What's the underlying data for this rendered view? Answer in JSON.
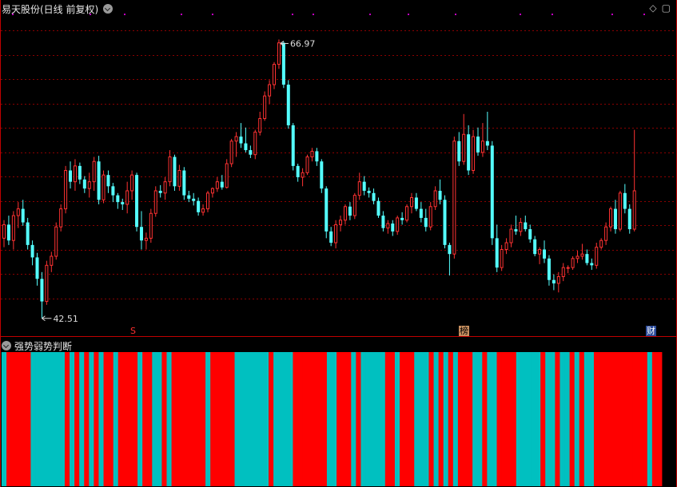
{
  "main_panel": {
    "title": "易天股份(日线 前复权)"
  },
  "sub_panel": {
    "title": "强势弱势判断"
  },
  "colors": {
    "up": "#ff3232",
    "down": "#54ffff",
    "strong": "#ff0000",
    "weak": "#00c0c0",
    "grid": "#8b0000"
  },
  "icons": [
    "chevron-down-icon",
    "diamond-icon",
    "maximize-icon"
  ],
  "markers": {
    "s_label": "S",
    "bang_label": "榜",
    "cai_label": "财"
  },
  "annotations": {
    "high_label": "66.97",
    "low_label": "42.51"
  },
  "chart_data": [
    {
      "type": "candlestick",
      "title": "易天股份(日线 前复权)",
      "ylim": [
        41,
        69
      ],
      "high": 66.97,
      "low": 42.51,
      "candles": [
        [
          49.6,
          51.2,
          48.8,
          50.8
        ],
        [
          50.8,
          51.6,
          49.0,
          49.4
        ],
        [
          49.4,
          52.0,
          48.6,
          51.6
        ],
        [
          51.6,
          52.8,
          50.5,
          52.2
        ],
        [
          52.2,
          53.0,
          50.7,
          51.0
        ],
        [
          51.0,
          51.4,
          48.6,
          49.0
        ],
        [
          49.0,
          49.4,
          47.2,
          47.9
        ],
        [
          47.9,
          48.3,
          45.4,
          46.0
        ],
        [
          46.0,
          46.6,
          42.5,
          44.0
        ],
        [
          44.0,
          47.6,
          43.7,
          47.2
        ],
        [
          47.2,
          48.4,
          46.6,
          48.0
        ],
        [
          48.0,
          51.0,
          47.7,
          50.6
        ],
        [
          50.6,
          52.6,
          50.2,
          52.2
        ],
        [
          52.2,
          56.0,
          51.8,
          55.6
        ],
        [
          55.6,
          56.4,
          54.0,
          54.6
        ],
        [
          54.6,
          56.6,
          53.8,
          56.0
        ],
        [
          56.0,
          56.3,
          54.4,
          54.8
        ],
        [
          54.8,
          55.1,
          53.6,
          54.0
        ],
        [
          54.0,
          55.4,
          53.2,
          54.6
        ],
        [
          54.6,
          56.8,
          53.8,
          56.4
        ],
        [
          56.4,
          56.9,
          52.6,
          53.0
        ],
        [
          53.0,
          55.6,
          52.7,
          55.2
        ],
        [
          55.2,
          55.6,
          53.6,
          54.2
        ],
        [
          54.2,
          54.5,
          52.8,
          53.4
        ],
        [
          53.4,
          53.6,
          52.2,
          52.8
        ],
        [
          52.8,
          53.1,
          52.1,
          52.6
        ],
        [
          52.6,
          54.6,
          51.8,
          53.8
        ],
        [
          53.8,
          55.6,
          53.0,
          55.2
        ],
        [
          55.2,
          55.4,
          50.2,
          50.6
        ],
        [
          50.6,
          52.0,
          48.6,
          49.4
        ],
        [
          49.4,
          50.1,
          48.6,
          49.6
        ],
        [
          49.6,
          52.2,
          49.2,
          51.8
        ],
        [
          51.8,
          54.2,
          51.5,
          53.8
        ],
        [
          53.8,
          54.3,
          53.2,
          53.6
        ],
        [
          53.6,
          55.0,
          53.0,
          54.6
        ],
        [
          54.6,
          57.4,
          54.2,
          56.8
        ],
        [
          56.8,
          57.0,
          53.8,
          54.2
        ],
        [
          54.2,
          56.1,
          53.8,
          55.6
        ],
        [
          55.6,
          55.9,
          53.0,
          53.4
        ],
        [
          53.4,
          53.8,
          52.8,
          53.1
        ],
        [
          53.1,
          53.6,
          52.5,
          52.9
        ],
        [
          52.9,
          53.2,
          51.6,
          51.9
        ],
        [
          51.9,
          52.6,
          51.6,
          52.2
        ],
        [
          52.2,
          53.8,
          51.9,
          53.6
        ],
        [
          53.6,
          54.1,
          53.2,
          54.0
        ],
        [
          54.0,
          55.0,
          53.7,
          54.6
        ],
        [
          54.6,
          55.2,
          53.9,
          54.1
        ],
        [
          54.1,
          56.6,
          54.0,
          56.2
        ],
        [
          56.2,
          58.4,
          55.9,
          58.2
        ],
        [
          58.2,
          59.0,
          56.8,
          58.6
        ],
        [
          58.6,
          59.8,
          57.6,
          58.0
        ],
        [
          58.0,
          59.4,
          57.2,
          57.4
        ],
        [
          57.4,
          57.8,
          56.7,
          57.0
        ],
        [
          57.0,
          59.2,
          56.6,
          59.0
        ],
        [
          59.0,
          60.8,
          58.7,
          60.2
        ],
        [
          60.2,
          62.6,
          60.0,
          62.2
        ],
        [
          62.2,
          63.6,
          61.5,
          63.2
        ],
        [
          63.2,
          65.2,
          62.8,
          65.0
        ],
        [
          65.0,
          67.2,
          64.6,
          66.9
        ],
        [
          66.9,
          67.0,
          62.9,
          63.2
        ],
        [
          63.2,
          63.6,
          59.3,
          59.6
        ],
        [
          59.6,
          59.8,
          55.6,
          56.0
        ],
        [
          56.0,
          56.2,
          54.6,
          55.0
        ],
        [
          55.0,
          55.8,
          54.2,
          55.4
        ],
        [
          55.4,
          57.0,
          55.2,
          56.8
        ],
        [
          56.8,
          57.6,
          56.4,
          57.3
        ],
        [
          57.3,
          57.6,
          56.0,
          56.4
        ],
        [
          56.4,
          56.6,
          53.6,
          54.0
        ],
        [
          54.0,
          54.2,
          49.6,
          50.2
        ],
        [
          50.2,
          50.6,
          48.9,
          49.2
        ],
        [
          49.2,
          51.2,
          48.7,
          50.8
        ],
        [
          50.8,
          51.6,
          50.2,
          51.2
        ],
        [
          51.2,
          52.6,
          50.8,
          52.4
        ],
        [
          52.4,
          52.8,
          51.2,
          51.6
        ],
        [
          51.6,
          53.6,
          51.3,
          53.4
        ],
        [
          53.4,
          55.4,
          53.0,
          54.6
        ],
        [
          54.6,
          55.1,
          53.4,
          53.8
        ],
        [
          53.8,
          54.1,
          53.2,
          53.6
        ],
        [
          53.6,
          54.0,
          52.6,
          52.9
        ],
        [
          52.9,
          53.2,
          51.4,
          51.6
        ],
        [
          51.6,
          52.0,
          50.2,
          50.5
        ],
        [
          50.5,
          51.2,
          50.0,
          50.9
        ],
        [
          50.9,
          51.2,
          49.8,
          50.2
        ],
        [
          50.2,
          51.6,
          49.9,
          51.4
        ],
        [
          51.4,
          51.9,
          50.8,
          51.2
        ],
        [
          51.2,
          52.6,
          51.0,
          52.4
        ],
        [
          52.4,
          53.6,
          51.8,
          53.2
        ],
        [
          53.2,
          53.6,
          52.0,
          52.2
        ],
        [
          52.2,
          52.8,
          51.0,
          51.4
        ],
        [
          51.4,
          52.2,
          50.2,
          50.6
        ],
        [
          50.6,
          52.8,
          50.3,
          52.4
        ],
        [
          52.4,
          54.2,
          52.1,
          53.8
        ],
        [
          53.8,
          54.8,
          52.6,
          53.0
        ],
        [
          53.0,
          53.4,
          48.7,
          49.0
        ],
        [
          49.0,
          49.2,
          46.3,
          48.2
        ],
        [
          48.2,
          58.6,
          47.8,
          58.2
        ],
        [
          58.2,
          59.0,
          56.0,
          56.4
        ],
        [
          56.4,
          60.6,
          56.1,
          58.8
        ],
        [
          58.8,
          59.6,
          55.2,
          55.6
        ],
        [
          55.6,
          59.2,
          55.3,
          58.6
        ],
        [
          58.6,
          59.4,
          56.9,
          57.2
        ],
        [
          57.2,
          59.8,
          56.8,
          58.2
        ],
        [
          58.2,
          60.8,
          57.4,
          57.8
        ],
        [
          57.8,
          58.2,
          49.0,
          49.6
        ],
        [
          49.6,
          50.8,
          46.6,
          47.0
        ],
        [
          47.0,
          49.0,
          46.7,
          48.6
        ],
        [
          48.6,
          49.6,
          48.2,
          49.2
        ],
        [
          49.2,
          50.8,
          48.8,
          50.4
        ],
        [
          50.4,
          51.6,
          49.9,
          50.2
        ],
        [
          50.2,
          51.4,
          49.8,
          51.0
        ],
        [
          51.0,
          51.6,
          50.2,
          50.4
        ],
        [
          50.4,
          50.8,
          49.2,
          49.5
        ],
        [
          49.5,
          49.8,
          48.0,
          48.2
        ],
        [
          48.2,
          48.8,
          47.3,
          48.6
        ],
        [
          48.6,
          49.4,
          47.4,
          47.8
        ],
        [
          47.8,
          48.1,
          45.4,
          45.9
        ],
        [
          45.9,
          46.4,
          45.0,
          45.6
        ],
        [
          45.6,
          46.6,
          44.8,
          46.2
        ],
        [
          46.2,
          47.4,
          45.8,
          47.0
        ],
        [
          47.0,
          47.2,
          46.5,
          47.0
        ],
        [
          47.0,
          48.0,
          46.8,
          47.8
        ],
        [
          47.8,
          48.5,
          47.4,
          48.0
        ],
        [
          48.0,
          49.1,
          47.7,
          48.2
        ],
        [
          48.2,
          48.6,
          47.2,
          47.4
        ],
        [
          47.4,
          47.8,
          46.8,
          47.2
        ],
        [
          47.2,
          49.2,
          46.9,
          48.8
        ],
        [
          48.8,
          49.6,
          48.6,
          49.4
        ],
        [
          49.4,
          51.0,
          49.0,
          50.6
        ],
        [
          50.6,
          52.4,
          50.2,
          52.2
        ],
        [
          52.2,
          53.0,
          50.0,
          50.4
        ],
        [
          50.4,
          53.8,
          50.2,
          53.6
        ],
        [
          53.6,
          54.4,
          51.8,
          52.2
        ],
        [
          52.2,
          52.6,
          50.0,
          50.4
        ],
        [
          50.4,
          59.2,
          50.2,
          53.8
        ]
      ]
    },
    {
      "type": "heatmap",
      "title": "强势弱势判断",
      "legend": [
        "强势",
        "弱势"
      ],
      "values": [
        0,
        1,
        1,
        1,
        1,
        1,
        0,
        0,
        0,
        0,
        0,
        0,
        0,
        1,
        0,
        1,
        0,
        1,
        0,
        1,
        0,
        1,
        1,
        0,
        1,
        1,
        1,
        1,
        0,
        1,
        1,
        0,
        0,
        1,
        0,
        1,
        1,
        1,
        1,
        1,
        1,
        1,
        0,
        1,
        1,
        1,
        1,
        1,
        0,
        0,
        0,
        0,
        0,
        0,
        0,
        1,
        0,
        0,
        0,
        0,
        1,
        1,
        1,
        1,
        1,
        1,
        1,
        0,
        0,
        1,
        1,
        1,
        0,
        1,
        0,
        0,
        0,
        0,
        0,
        1,
        1,
        0,
        1,
        1,
        1,
        0,
        0,
        0,
        1,
        0,
        1,
        0,
        1,
        0,
        1,
        1,
        1,
        0,
        0,
        1,
        0,
        0,
        1,
        1,
        1,
        1,
        0,
        0,
        0,
        0,
        0,
        1,
        0,
        0,
        1,
        0,
        0,
        1,
        0,
        1,
        0,
        0,
        1,
        1,
        1,
        1,
        1,
        1,
        1,
        1,
        1,
        1,
        1,
        0,
        1,
        1
      ]
    }
  ]
}
